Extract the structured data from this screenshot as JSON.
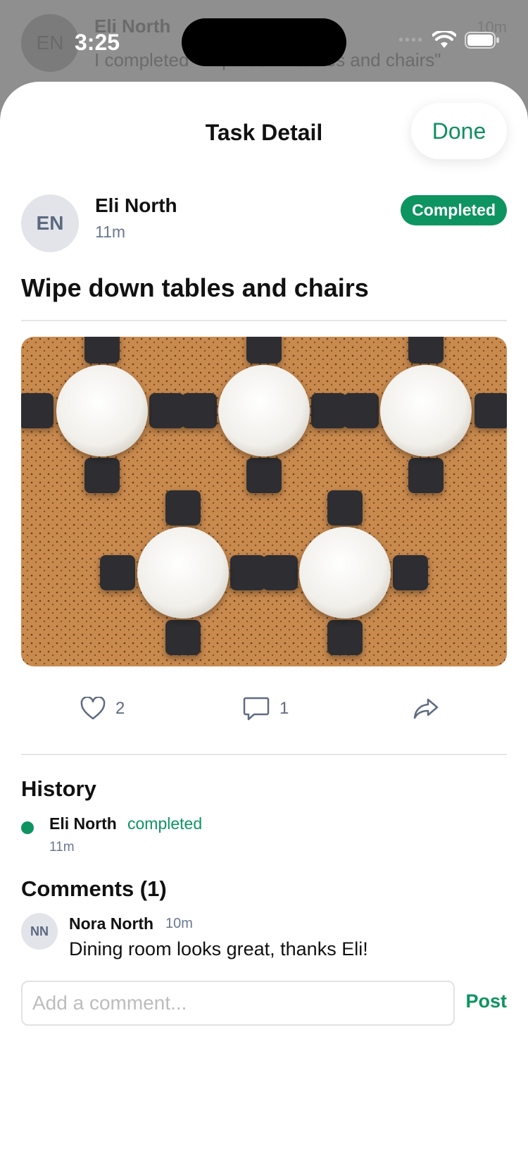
{
  "background": {
    "avatar_initials": "EN",
    "name": "Eli North",
    "time": "10m",
    "message": "I completed \"Wipe down tables and chairs\""
  },
  "status_bar": {
    "time": "3:25"
  },
  "sheet": {
    "title": "Task Detail",
    "done_label": "Done"
  },
  "task": {
    "author_initials": "EN",
    "author_name": "Eli North",
    "posted_time": "11m",
    "status": "Completed",
    "title": "Wipe down tables and chairs",
    "photo_icon": "dining-tables-photo",
    "likes": "2",
    "comments": "1"
  },
  "history": {
    "heading": "History",
    "entries": [
      {
        "name": "Eli North",
        "action": "completed",
        "time": "11m"
      }
    ]
  },
  "comments": {
    "heading": "Comments (1)",
    "items": [
      {
        "initials": "NN",
        "name": "Nora North",
        "time": "10m",
        "text": "Dining room looks great, thanks Eli!"
      }
    ],
    "input_placeholder": "Add a comment...",
    "post_label": "Post"
  },
  "colors": {
    "accent": "#0e9460",
    "badge_bg": "#0e9460",
    "table": "#f5f3ef",
    "floor": "#c98a4e",
    "chair": "#2d2f33"
  }
}
